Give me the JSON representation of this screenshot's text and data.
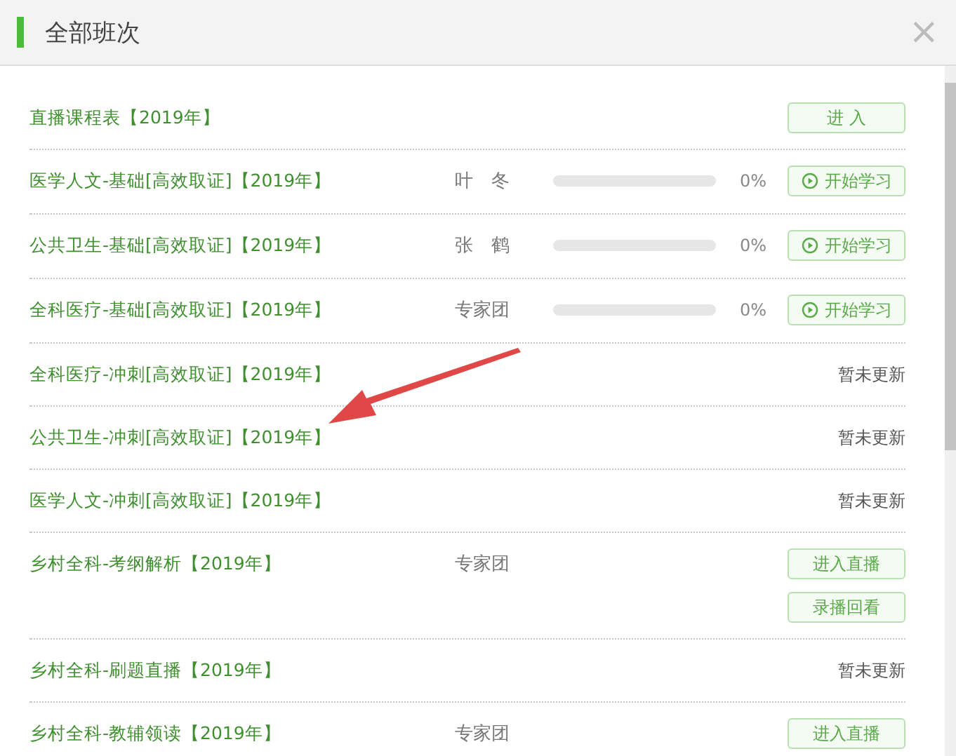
{
  "dialog": {
    "title": "全部班次",
    "close": "×"
  },
  "rows": [
    {
      "title": "直播课程表【2019年】",
      "actions": [
        {
          "label": "进 入",
          "kind": "plain"
        }
      ]
    },
    {
      "title": "医学人文-基础[高效取证]【2019年】",
      "teacher": "叶　冬",
      "progress": {
        "level": 0,
        "reading": "0%"
      },
      "actions": [
        {
          "label": "开始学习",
          "kind": "start"
        }
      ]
    },
    {
      "title": "公共卫生-基础[高效取证]【2019年】",
      "teacher": "张　鹤",
      "progress": {
        "level": 0,
        "reading": "0%"
      },
      "actions": [
        {
          "label": "开始学习",
          "kind": "start"
        }
      ]
    },
    {
      "title": "全科医疗-基础[高效取证]【2019年】",
      "teacher": "专家团",
      "progress": {
        "level": 0,
        "reading": "0%"
      },
      "actions": [
        {
          "label": "开始学习",
          "kind": "start"
        }
      ]
    },
    {
      "title": "全科医疗-冲刺[高效取证]【2019年】",
      "status": "暂未更新"
    },
    {
      "title": "公共卫生-冲刺[高效取证]【2019年】",
      "status": "暂未更新"
    },
    {
      "title": "医学人文-冲刺[高效取证]【2019年】",
      "status": "暂未更新"
    },
    {
      "title": "乡村全科-考纲解析【2019年】",
      "teacher": "专家团",
      "actions": [
        {
          "label": "进入直播",
          "kind": "plain"
        },
        {
          "label": "录播回看",
          "kind": "plain"
        }
      ]
    },
    {
      "title": "乡村全科-刷题直播【2019年】",
      "status": "暂未更新"
    },
    {
      "title": "乡村全科-教辅领读【2019年】",
      "teacher": "专家团",
      "actions": [
        {
          "label": "进入直播",
          "kind": "plain"
        }
      ]
    }
  ],
  "annotation": {
    "kind": "arrow"
  }
}
